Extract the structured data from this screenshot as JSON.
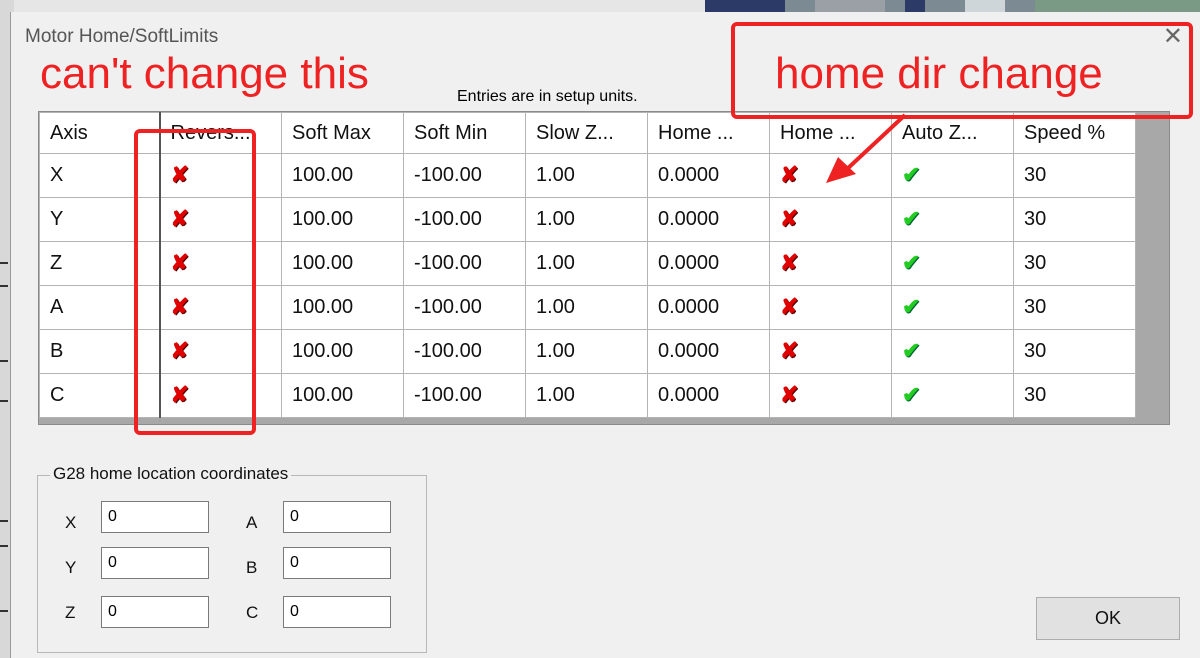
{
  "dialog": {
    "title": "Motor Home/SoftLimits",
    "note": "Entries are in setup units.",
    "ok_label": "OK"
  },
  "table": {
    "columns": [
      "Axis",
      "Revers...",
      "Soft Max",
      "Soft Min",
      "Slow Z...",
      "Home ...",
      "Home ...",
      "Auto Z...",
      "Speed %"
    ],
    "rows": [
      {
        "axis": "X",
        "reversed": "x-icon",
        "soft_max": "100.00",
        "soft_min": "-100.00",
        "slow_zone": "1.00",
        "home_offset": "0.0000",
        "home_dir": "x-icon",
        "auto_zero": "check-icon",
        "speed": "30"
      },
      {
        "axis": "Y",
        "reversed": "x-icon",
        "soft_max": "100.00",
        "soft_min": "-100.00",
        "slow_zone": "1.00",
        "home_offset": "0.0000",
        "home_dir": "x-icon",
        "auto_zero": "check-icon",
        "speed": "30"
      },
      {
        "axis": "Z",
        "reversed": "x-icon",
        "soft_max": "100.00",
        "soft_min": "-100.00",
        "slow_zone": "1.00",
        "home_offset": "0.0000",
        "home_dir": "x-icon",
        "auto_zero": "check-icon",
        "speed": "30"
      },
      {
        "axis": "A",
        "reversed": "x-icon",
        "soft_max": "100.00",
        "soft_min": "-100.00",
        "slow_zone": "1.00",
        "home_offset": "0.0000",
        "home_dir": "x-icon",
        "auto_zero": "check-icon",
        "speed": "30"
      },
      {
        "axis": "B",
        "reversed": "x-icon",
        "soft_max": "100.00",
        "soft_min": "-100.00",
        "slow_zone": "1.00",
        "home_offset": "0.0000",
        "home_dir": "x-icon",
        "auto_zero": "check-icon",
        "speed": "30"
      },
      {
        "axis": "C",
        "reversed": "x-icon",
        "soft_max": "100.00",
        "soft_min": "-100.00",
        "slow_zone": "1.00",
        "home_offset": "0.0000",
        "home_dir": "x-icon",
        "auto_zero": "check-icon",
        "speed": "30"
      }
    ]
  },
  "g28": {
    "title": "G28 home location coordinates",
    "fields": [
      {
        "label": "X",
        "value": "0"
      },
      {
        "label": "Y",
        "value": "0"
      },
      {
        "label": "Z",
        "value": "0"
      },
      {
        "label": "A",
        "value": "0"
      },
      {
        "label": "B",
        "value": "0"
      },
      {
        "label": "C",
        "value": "0"
      }
    ]
  },
  "annotations": {
    "left_text": "can't change this",
    "right_text": "home dir change",
    "color": "#ee2222"
  },
  "colors": {
    "x_icon": "#e00000",
    "check_icon": "#22cc22"
  }
}
